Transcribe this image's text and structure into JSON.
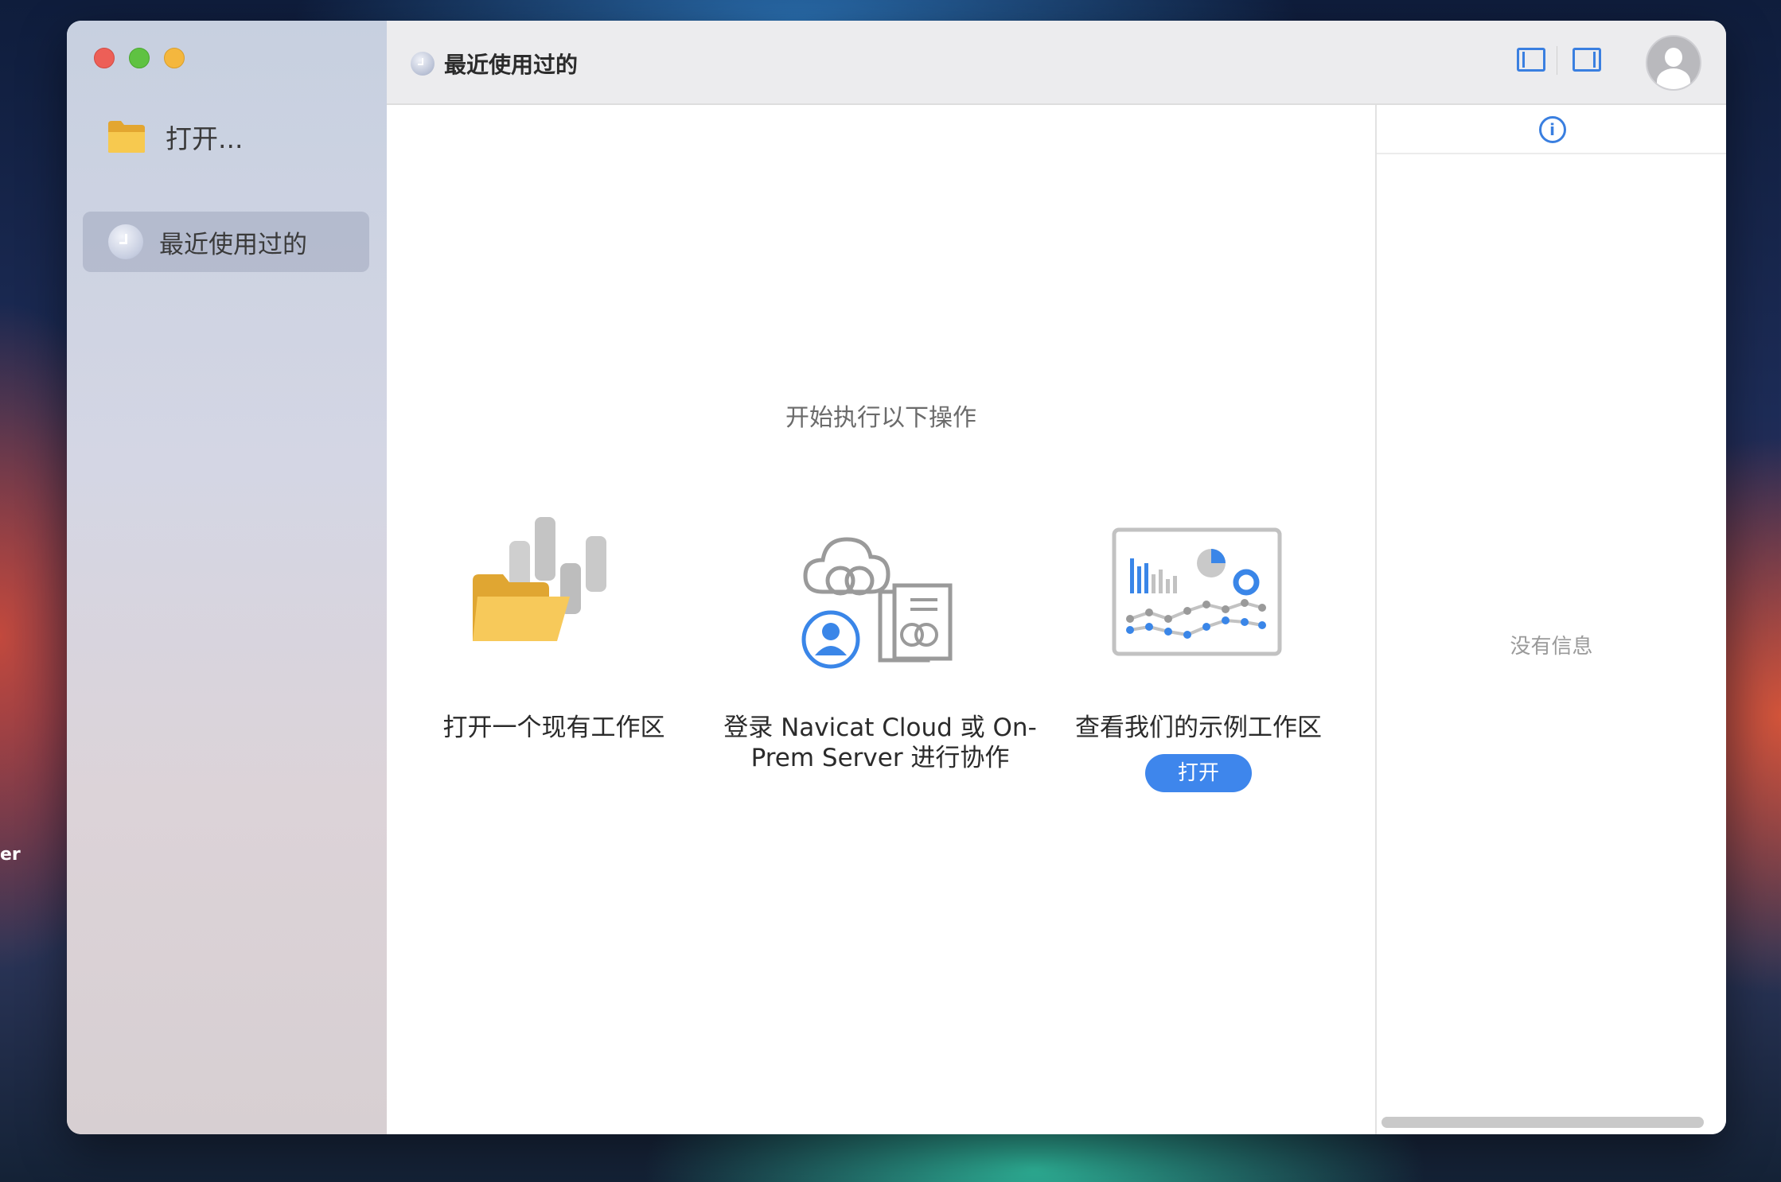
{
  "desktop": {
    "edge_text": "er"
  },
  "sidebar": {
    "open_label": "打开...",
    "recent_label": "最近使用过的"
  },
  "toolbar": {
    "title": "最近使用过的"
  },
  "main": {
    "heading": "开始执行以下操作",
    "cards": [
      {
        "caption": "打开一个现有工作区"
      },
      {
        "caption": "登录 Navicat Cloud 或 On-Prem Server 进行协作"
      },
      {
        "caption": "查看我们的示例工作区",
        "button": "打开"
      }
    ]
  },
  "info_panel": {
    "empty_text": "没有信息"
  },
  "colors": {
    "accent": "#3e86ec",
    "folder": "#f4c04d",
    "red": "#ed5f57",
    "green": "#5fc242",
    "yellow": "#f4b73e"
  }
}
